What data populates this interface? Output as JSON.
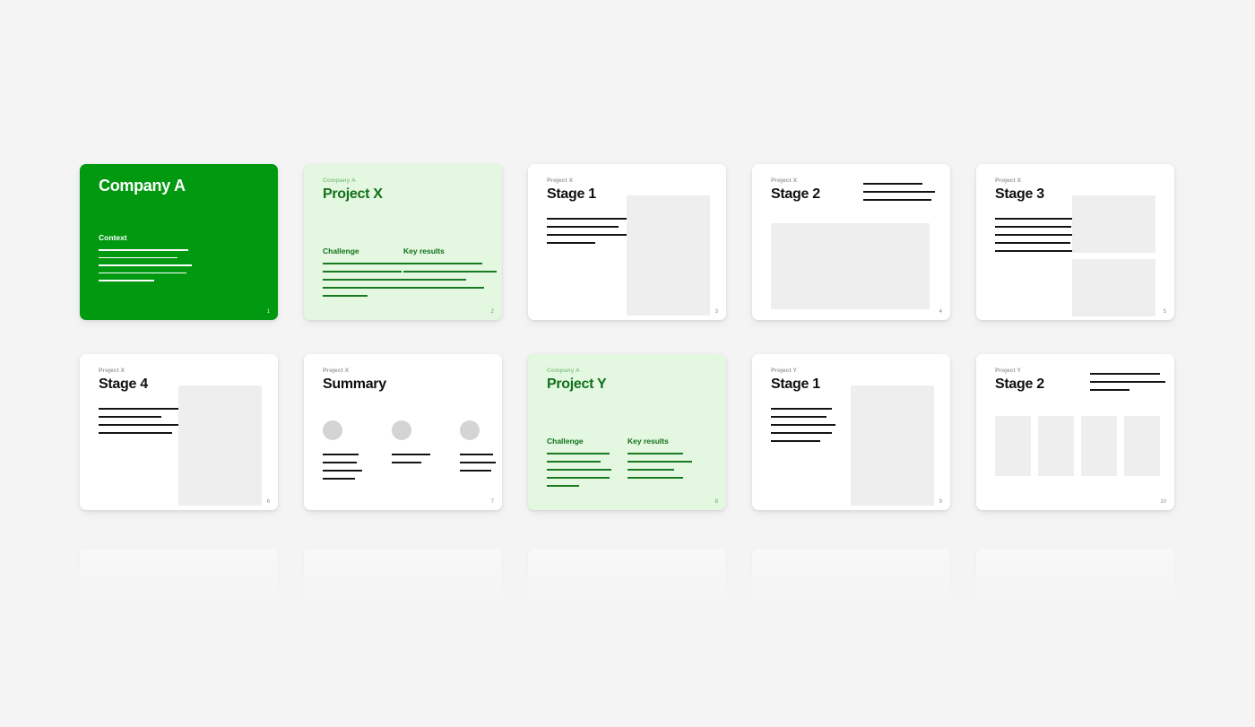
{
  "background_color": "#f4f4f4",
  "theme": {
    "brand_green": "#009910",
    "light_green_bg": "#e3f7e1",
    "light_green_text": "#12701a",
    "rule_dark": "#141414",
    "block_grey": "#eeeeee",
    "avatar_grey": "#d4d4d4"
  },
  "deck": {
    "slides": [
      {
        "index": 0,
        "page_number": "1",
        "layout": "cover",
        "theme": "dark",
        "eyebrow": "",
        "title": "Company A",
        "section_heading": "Context",
        "rule_widths": [
          100,
          88,
          104,
          98,
          62
        ]
      },
      {
        "index": 1,
        "page_number": "2",
        "layout": "twocol",
        "theme": "light",
        "eyebrow": "Company A",
        "title": "Project X",
        "columns": [
          {
            "heading": "Challenge",
            "rule_widths": [
              100,
              88,
              104,
              100,
              50
            ]
          },
          {
            "heading": "Key results",
            "rule_widths": [
              88,
              104,
              70,
              90
            ]
          }
        ]
      },
      {
        "index": 2,
        "page_number": "3",
        "layout": "textblock",
        "theme": "plain",
        "eyebrow": "Project X",
        "title": "Stage 1",
        "rule_widths": [
          92,
          80,
          98,
          54
        ]
      },
      {
        "index": 3,
        "page_number": "4",
        "layout": "wideblock",
        "theme": "plain",
        "eyebrow": "Project X",
        "title": "Stage 2",
        "head_rule_widths": [
          66,
          80,
          76
        ]
      },
      {
        "index": 4,
        "page_number": "5",
        "layout": "twoblock",
        "theme": "plain",
        "eyebrow": "Project X",
        "title": "Stage 3",
        "rule_widths": [
          92,
          85,
          100,
          84,
          88
        ]
      },
      {
        "index": 5,
        "page_number": "6",
        "layout": "textblock",
        "theme": "plain",
        "eyebrow": "Project X",
        "title": "Stage 4",
        "rule_widths": [
          92,
          70,
          98,
          82
        ]
      },
      {
        "index": 6,
        "page_number": "7",
        "layout": "summary",
        "theme": "plain",
        "eyebrow": "Project X",
        "title": "Summary",
        "columns": [
          {
            "rule_widths": [
              40,
              38,
              44,
              36
            ]
          },
          {
            "rule_widths": [
              43,
              33
            ]
          },
          {
            "rule_widths": [
              37,
              40,
              35
            ]
          }
        ]
      },
      {
        "index": 7,
        "page_number": "8",
        "layout": "twocol",
        "theme": "light",
        "eyebrow": "Company A",
        "title": "Project Y",
        "columns": [
          {
            "heading": "Challenge",
            "rule_widths": [
              70,
              60,
              72,
              70,
              36
            ]
          },
          {
            "heading": "Key results",
            "rule_widths": [
              62,
              72,
              52,
              62
            ]
          }
        ]
      },
      {
        "index": 8,
        "page_number": "9",
        "layout": "textblock",
        "theme": "plain",
        "eyebrow": "Project Y",
        "title": "Stage 1",
        "rule_widths": [
          68,
          62,
          72,
          68,
          55
        ]
      },
      {
        "index": 9,
        "page_number": "10",
        "layout": "fourblock",
        "theme": "plain",
        "eyebrow": "Project Y",
        "title": "Stage 2",
        "head_rule_widths": [
          78,
          84,
          44
        ]
      }
    ],
    "ghost_row_count": 5
  }
}
